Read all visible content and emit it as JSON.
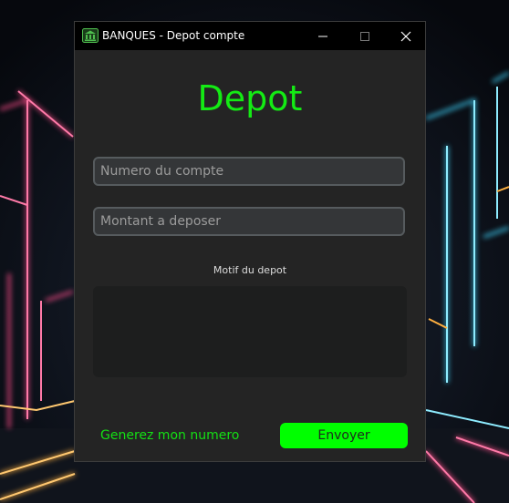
{
  "window": {
    "title": "BANQUES - Depot compte",
    "app_icon": "bank-icon",
    "controls": [
      "minimize-icon",
      "maximize-icon",
      "close-icon"
    ]
  },
  "form": {
    "heading": "Depot",
    "account_placeholder": "Numero du compte",
    "amount_placeholder": "Montant a deposer",
    "motif_label": "Motif du depot",
    "motif_value": ""
  },
  "actions": {
    "generate_label": "Generez mon numero",
    "send_label": "Envoyer"
  },
  "colors": {
    "accent_green": "#14ea14",
    "button_green": "#00ff00",
    "window_bg": "#242424",
    "titlebar_bg": "#000000"
  }
}
